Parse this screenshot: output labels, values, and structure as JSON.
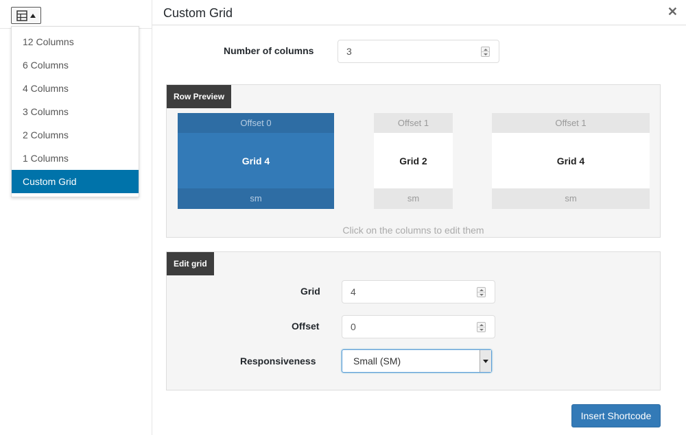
{
  "toolbar": {
    "grid_button_icon": "table-grid-icon"
  },
  "dropdown": {
    "items": [
      {
        "label": "12 Columns"
      },
      {
        "label": "6 Columns"
      },
      {
        "label": "4 Columns"
      },
      {
        "label": "3 Columns"
      },
      {
        "label": "2 Columns"
      },
      {
        "label": "1 Columns"
      },
      {
        "label": "Custom Grid",
        "active": true
      }
    ]
  },
  "modal": {
    "title": "Custom Grid",
    "close_icon": "close-icon",
    "columns_label": "Number of columns",
    "columns_value": "3"
  },
  "preview": {
    "tag": "Row Preview",
    "columns": [
      {
        "offset": "Offset 0",
        "grid": "Grid 4",
        "size": "sm",
        "selected": true
      },
      {
        "offset": "Offset 1",
        "grid": "Grid 2",
        "size": "sm",
        "selected": false
      },
      {
        "offset": "Offset 1",
        "grid": "Grid 4",
        "size": "sm",
        "selected": false
      }
    ],
    "hint": "Click on the columns to edit them"
  },
  "edit": {
    "tag": "Edit grid",
    "grid_label": "Grid",
    "grid_value": "4",
    "offset_label": "Offset",
    "offset_value": "0",
    "responsive_label": "Responsiveness",
    "responsive_value": "Small (SM)"
  },
  "footer": {
    "insert_label": "Insert Shortcode"
  },
  "colors": {
    "accent": "#0073aa",
    "primary": "#337ab7",
    "panel_tag": "#3d3d3d"
  }
}
